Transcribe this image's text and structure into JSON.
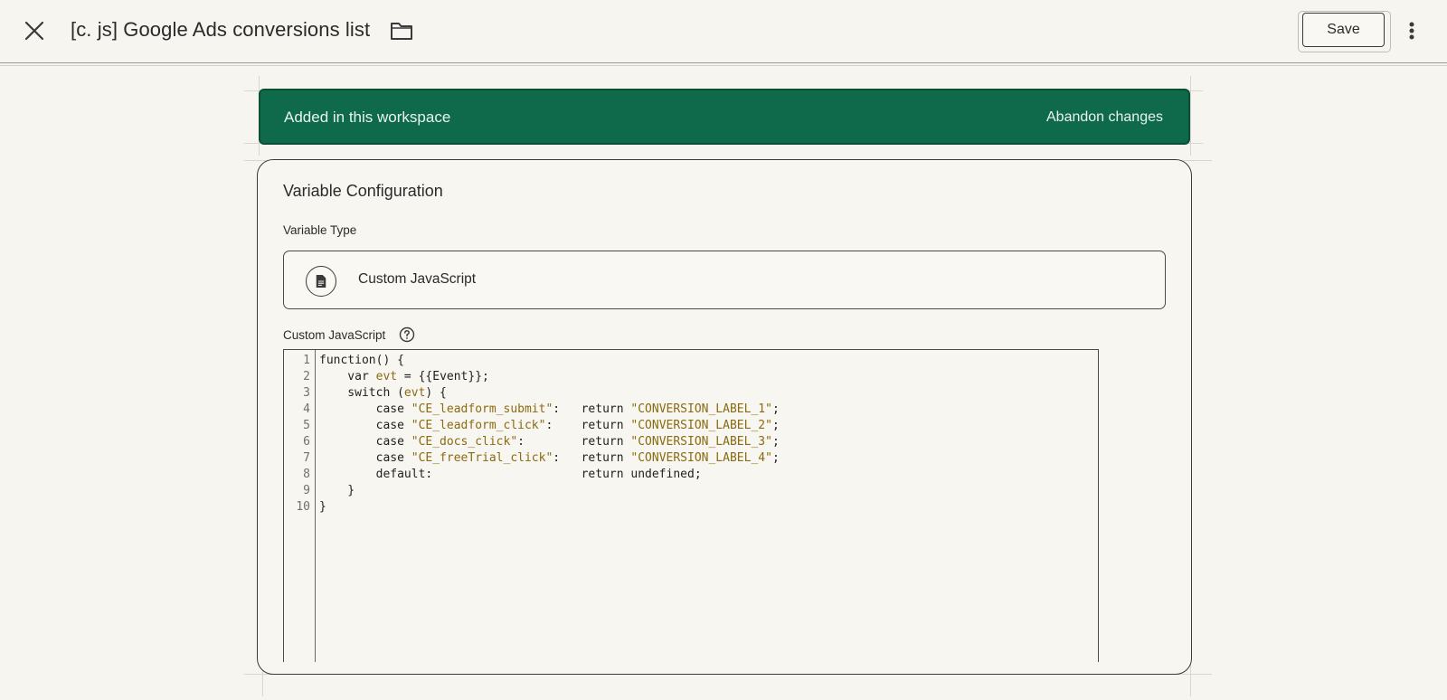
{
  "header": {
    "title": "[c. js] Google Ads conversions list",
    "save_label": "Save",
    "close_icon": "close-icon",
    "folder_icon": "folder-icon",
    "more_icon": "more-vert-icon"
  },
  "banner": {
    "text": "Added in this workspace",
    "action": "Abandon changes",
    "color": "#0e6a4a"
  },
  "config": {
    "title": "Variable Configuration",
    "variable_type_label": "Variable Type",
    "variable_type_value": "Custom JavaScript",
    "variable_type_icon": "script-doc-icon",
    "code_label": "Custom JavaScript",
    "help_icon": "help-icon"
  },
  "code": {
    "line_numbers": [
      "1",
      "2",
      "3",
      "4",
      "5",
      "6",
      "7",
      "8",
      "9",
      "10"
    ],
    "lines": [
      [
        {
          "t": "pl",
          "v": "function() {"
        }
      ],
      [
        {
          "t": "pl",
          "v": "    var "
        },
        {
          "t": "var",
          "v": "evt"
        },
        {
          "t": "pl",
          "v": " = {{Event}};"
        }
      ],
      [
        {
          "t": "pl",
          "v": "    switch ("
        },
        {
          "t": "var",
          "v": "evt"
        },
        {
          "t": "pl",
          "v": ") {"
        }
      ],
      [
        {
          "t": "pl",
          "v": "        case "
        },
        {
          "t": "str",
          "v": "\"CE_leadform_submit\""
        },
        {
          "t": "pl",
          "v": ":   return "
        },
        {
          "t": "str",
          "v": "\"CONVERSION_LABEL_1\""
        },
        {
          "t": "pl",
          "v": ";"
        }
      ],
      [
        {
          "t": "pl",
          "v": "        case "
        },
        {
          "t": "str",
          "v": "\"CE_leadform_click\""
        },
        {
          "t": "pl",
          "v": ":    return "
        },
        {
          "t": "str",
          "v": "\"CONVERSION_LABEL_2\""
        },
        {
          "t": "pl",
          "v": ";"
        }
      ],
      [
        {
          "t": "pl",
          "v": "        case "
        },
        {
          "t": "str",
          "v": "\"CE_docs_click\""
        },
        {
          "t": "pl",
          "v": ":        return "
        },
        {
          "t": "str",
          "v": "\"CONVERSION_LABEL_3\""
        },
        {
          "t": "pl",
          "v": ";"
        }
      ],
      [
        {
          "t": "pl",
          "v": "        case "
        },
        {
          "t": "str",
          "v": "\"CE_freeTrial_click\""
        },
        {
          "t": "pl",
          "v": ":   return "
        },
        {
          "t": "str",
          "v": "\"CONVERSION_LABEL_4\""
        },
        {
          "t": "pl",
          "v": ";"
        }
      ],
      [
        {
          "t": "pl",
          "v": "        default:                     return undefined;"
        }
      ],
      [
        {
          "t": "pl",
          "v": "    }"
        }
      ],
      [
        {
          "t": "pl",
          "v": "}"
        }
      ]
    ]
  }
}
